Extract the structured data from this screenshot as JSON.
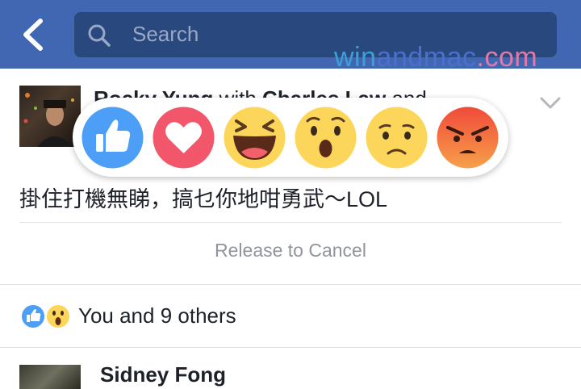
{
  "header": {
    "search_placeholder": "Search"
  },
  "watermark": {
    "part1": "win",
    "part2": "andmac",
    "part3": ".com"
  },
  "post": {
    "author_name": "Rocky Yung",
    "with_text": " with ",
    "tagged_name": "Charles Law",
    "and_text": " and",
    "status_text": "掛住打機無睇，搞乜你地咁勇武～LOL",
    "release_text": "Release to Cancel"
  },
  "reactions": {
    "items": [
      "like",
      "love",
      "haha",
      "wow",
      "sad",
      "angry"
    ]
  },
  "likes": {
    "summary": "You and 9 others"
  },
  "comment": {
    "author": "Sidney Fong"
  },
  "colors": {
    "navbar": "#4267b2",
    "search_bg": "#29487d",
    "like_blue": "#4c9ef7",
    "love_red": "#f1566a",
    "yellow": "#fcd65a",
    "angry_top": "#f04a3a",
    "angry_bottom": "#f6a04a"
  }
}
